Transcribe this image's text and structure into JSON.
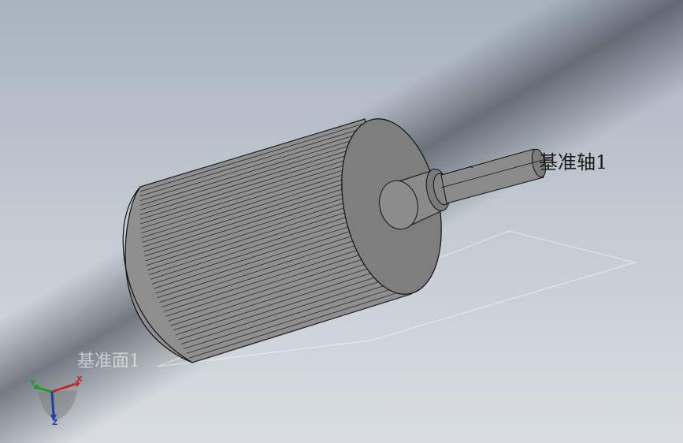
{
  "viewport": {
    "axis_label": "基准轴1",
    "plane_label": "基准面1"
  },
  "triad": {
    "x": "X",
    "y": "Y",
    "z": "Z",
    "x_color": "#c0282a",
    "y_color": "#1e9a2e",
    "z_color": "#1f3fa8"
  },
  "model": {
    "type": "splined roller with stepped shaft",
    "body_color": "#8e8e8e",
    "face_color": "#7d7d7d",
    "edge_color": "#111111"
  }
}
